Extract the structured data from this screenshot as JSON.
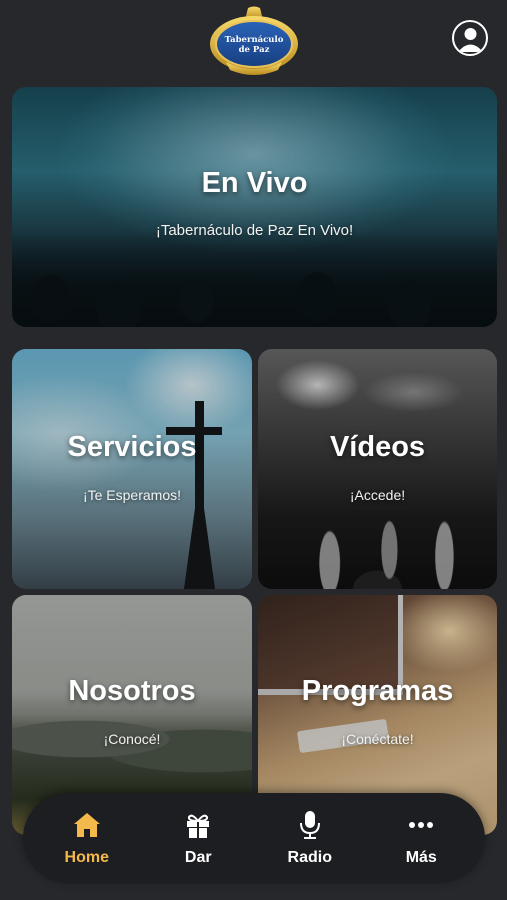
{
  "header": {
    "logo_line1": "Tabernáculo",
    "logo_line2": "de Paz",
    "profile_icon": "person-circle-icon"
  },
  "cards": {
    "live": {
      "title": "En Vivo",
      "subtitle": "¡Tabernáculo de Paz En Vivo!"
    },
    "services": {
      "title": "Servicios",
      "subtitle": "¡Te Esperamos!"
    },
    "videos": {
      "title": "Vídeos",
      "subtitle": "¡Accede!"
    },
    "about": {
      "title": "Nosotros",
      "subtitle": "¡Conocé!"
    },
    "programs": {
      "title": "Programas",
      "subtitle": "¡Conéctate!"
    }
  },
  "bottom_nav": {
    "items": [
      {
        "label": "Home",
        "icon": "home-icon",
        "active": true
      },
      {
        "label": "Dar",
        "icon": "gift-icon",
        "active": false
      },
      {
        "label": "Radio",
        "icon": "microphone-icon",
        "active": false
      },
      {
        "label": "Más",
        "icon": "more-dots-icon",
        "active": false
      }
    ],
    "active_color": "#f3b94a",
    "inactive_color": "#ffffff"
  },
  "colors": {
    "background": "#27282c",
    "nav_background": "#1d1e22"
  }
}
